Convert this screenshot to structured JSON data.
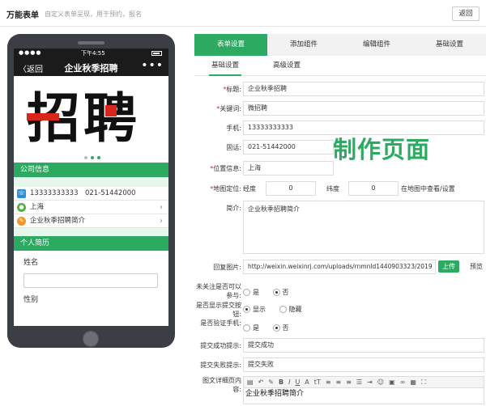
{
  "header": {
    "title": "万能表单",
    "subtitle": "自定义表单呈现，用于预约，报名",
    "back_label": "返回"
  },
  "phone": {
    "status_time": "下午4:55",
    "nav_back": "〈返回",
    "nav_title": "企业秋季招聘",
    "nav_more": "•••",
    "banner_text": "招聘",
    "section_company": "公司信息",
    "contact_phone": "13333333333　021-51442000",
    "contact_location": "上海",
    "contact_intro": "企业秋季招聘简介",
    "section_personal": "个人简历",
    "field_name": "姓名",
    "field_gender": "性别"
  },
  "tabs": [
    {
      "label": "表单设置",
      "active": true
    },
    {
      "label": "添加组件",
      "active": false
    },
    {
      "label": "编辑组件",
      "active": false
    },
    {
      "label": "基础设置",
      "active": false
    }
  ],
  "subtabs": [
    {
      "label": "基础设置",
      "active": true
    },
    {
      "label": "高级设置",
      "active": false
    }
  ],
  "form": {
    "title_label": "标题:",
    "title_value": "企业秋季招聘",
    "keyword_label": "关键词:",
    "keyword_value": "微招聘",
    "mobile_label": "手机:",
    "mobile_value": "13333333333",
    "tel_label": "固话:",
    "tel_value": "021-51442000",
    "location_label": "位置信息:",
    "location_value": "上海",
    "map_label": "地图定位:",
    "lng_label": "经度",
    "lng_value": "0",
    "lat_label": "纬度",
    "lat_value": "0",
    "map_link": "在地图中查看/设置",
    "intro_label": "简介:",
    "intro_value": "企业秋季招聘简介",
    "image_label": "回复图片:",
    "image_value": "http://weixin.weixinrj.com/uploads/rnmnld1440903323/2019",
    "upload_label": "上传",
    "preview_label": "预览",
    "follow_label": "未关注是否可以参与:",
    "follow_yes": "是",
    "follow_no": "否",
    "show_submit_label": "是否显示提交按钮:",
    "show_submit_show": "显示",
    "show_submit_hide": "隐藏",
    "verify_label": "是否验证手机:",
    "verify_yes": "是",
    "verify_no": "否",
    "success_label": "提交成功提示:",
    "success_value": "提交成功",
    "fail_label": "提交失败提示:",
    "fail_value": "提交失败",
    "detail_label": "图文详细页内容:",
    "detail_value": "企业秋季招聘简介"
  },
  "watermark": "制作页面",
  "colors": {
    "accent": "#2daa61",
    "danger": "#d9261c",
    "phone_body": "#3b3f45"
  }
}
